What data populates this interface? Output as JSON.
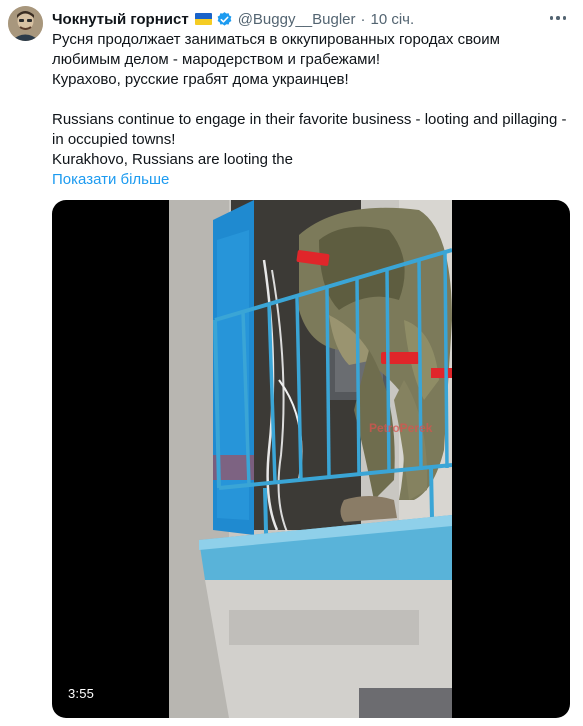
{
  "tweet": {
    "display_name": "Чокнутый горнист",
    "handle": "@Buggy__Bugler",
    "separator": "·",
    "time": "10 січ.",
    "text_lines_ru": [
      "Русня продолжает заниматься в оккупированных городах своим",
      "любимым делом - мародерством и грабежами!",
      "Курахово, русские грабят дома украинцев!"
    ],
    "text_lines_en": [
      "Russians continue to engage in their favorite business - looting and pillaging -",
      "in occupied towns!",
      "Kurakhovo, Russians are looting the"
    ],
    "show_more": "Показати більше"
  },
  "video": {
    "duration": "3:55",
    "watermark": "PetroPеrek"
  },
  "colors": {
    "link": "#1d9bf0",
    "secondary_text": "#536471",
    "verified": "#1d9bf0",
    "flag_blue": "#1a63c9",
    "flag_yellow": "#f5cc23",
    "railing": "#3aa5d6"
  },
  "icons": {
    "verified": "verified-badge-icon",
    "flag": "ukraine-flag-icon",
    "more": "more-options-icon"
  }
}
